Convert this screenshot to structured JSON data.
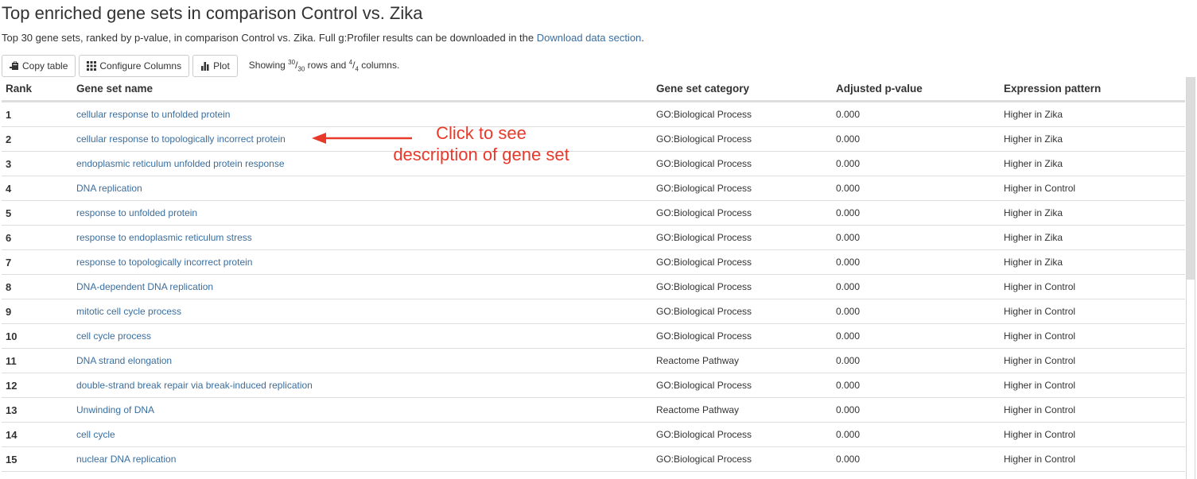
{
  "header": {
    "title": "Top enriched gene sets in comparison Control vs. Zika",
    "intro_text": "Top 30 gene sets, ranked by p-value, in comparison Control vs. Zika. Full g:Profiler results can be downloaded in the ",
    "intro_link": "Download data section",
    "intro_suffix": "."
  },
  "toolbar": {
    "copy_label": "Copy table",
    "copy_icon": "clipboard-icon",
    "configure_label": "Configure Columns",
    "configure_icon": "grid-icon",
    "plot_label": "Plot",
    "plot_icon": "bar-chart-icon",
    "status": {
      "prefix": "Showing ",
      "rows_shown": "30",
      "rows_total": "30",
      "mid": " rows and ",
      "cols_shown": "4",
      "cols_total": "4",
      "suffix": " columns."
    }
  },
  "table": {
    "columns": [
      "Rank",
      "Gene set name",
      "Gene set category",
      "Adjusted p-value",
      "Expression pattern"
    ],
    "rows": [
      {
        "rank": "1",
        "name": "cellular response to unfolded protein",
        "category": "GO:Biological Process",
        "pvalue": "0.000",
        "pattern": "Higher in Zika"
      },
      {
        "rank": "2",
        "name": "cellular response to topologically incorrect protein",
        "category": "GO:Biological Process",
        "pvalue": "0.000",
        "pattern": "Higher in Zika"
      },
      {
        "rank": "3",
        "name": "endoplasmic reticulum unfolded protein response",
        "category": "GO:Biological Process",
        "pvalue": "0.000",
        "pattern": "Higher in Zika"
      },
      {
        "rank": "4",
        "name": "DNA replication",
        "category": "GO:Biological Process",
        "pvalue": "0.000",
        "pattern": "Higher in Control"
      },
      {
        "rank": "5",
        "name": "response to unfolded protein",
        "category": "GO:Biological Process",
        "pvalue": "0.000",
        "pattern": "Higher in Zika"
      },
      {
        "rank": "6",
        "name": "response to endoplasmic reticulum stress",
        "category": "GO:Biological Process",
        "pvalue": "0.000",
        "pattern": "Higher in Zika"
      },
      {
        "rank": "7",
        "name": "response to topologically incorrect protein",
        "category": "GO:Biological Process",
        "pvalue": "0.000",
        "pattern": "Higher in Zika"
      },
      {
        "rank": "8",
        "name": "DNA-dependent DNA replication",
        "category": "GO:Biological Process",
        "pvalue": "0.000",
        "pattern": "Higher in Control"
      },
      {
        "rank": "9",
        "name": "mitotic cell cycle process",
        "category": "GO:Biological Process",
        "pvalue": "0.000",
        "pattern": "Higher in Control"
      },
      {
        "rank": "10",
        "name": "cell cycle process",
        "category": "GO:Biological Process",
        "pvalue": "0.000",
        "pattern": "Higher in Control"
      },
      {
        "rank": "11",
        "name": "DNA strand elongation",
        "category": "Reactome Pathway",
        "pvalue": "0.000",
        "pattern": "Higher in Control"
      },
      {
        "rank": "12",
        "name": "double-strand break repair via break-induced replication",
        "category": "GO:Biological Process",
        "pvalue": "0.000",
        "pattern": "Higher in Control"
      },
      {
        "rank": "13",
        "name": "Unwinding of DNA",
        "category": "Reactome Pathway",
        "pvalue": "0.000",
        "pattern": "Higher in Control"
      },
      {
        "rank": "14",
        "name": "cell cycle",
        "category": "GO:Biological Process",
        "pvalue": "0.000",
        "pattern": "Higher in Control"
      },
      {
        "rank": "15",
        "name": "nuclear DNA replication",
        "category": "GO:Biological Process",
        "pvalue": "0.000",
        "pattern": "Higher in Control"
      }
    ]
  },
  "annotation": {
    "line1": "Click to see",
    "line2": "description of gene set",
    "color": "#e8392b"
  },
  "colors": {
    "link": "#3b6e9e",
    "text": "#333333",
    "border": "#dddddd"
  }
}
